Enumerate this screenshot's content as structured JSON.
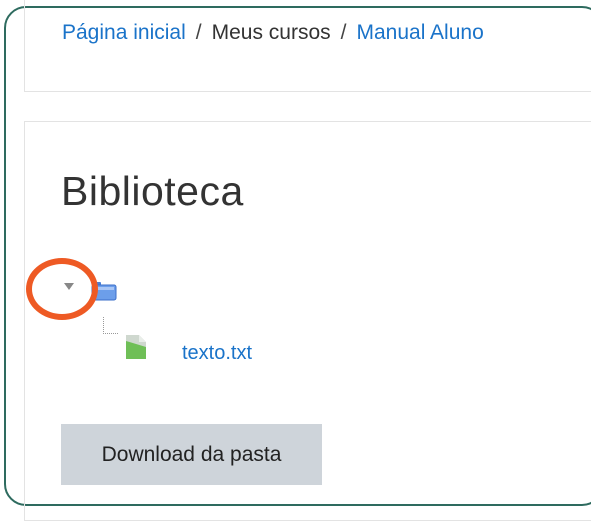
{
  "breadcrumb": {
    "items": [
      "Página inicial",
      "Meus cursos",
      "Manual Aluno"
    ],
    "separator": "/"
  },
  "page": {
    "title": "Biblioteca"
  },
  "tree": {
    "folder_icon": "folder-icon",
    "files": [
      {
        "name": "texto.txt",
        "icon": "text-file-icon"
      }
    ]
  },
  "actions": {
    "download_label": "Download da pasta"
  },
  "colors": {
    "link": "#1a73c9",
    "highlight": "#ee5a24",
    "frame": "#2e6b5f",
    "button": "#ced4da"
  }
}
